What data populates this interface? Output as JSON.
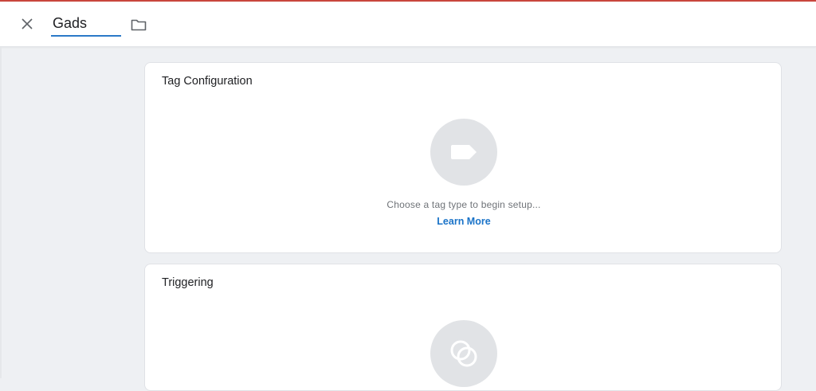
{
  "header": {
    "close_icon": "close-icon",
    "name_value": "Gads",
    "folder_icon": "folder-icon"
  },
  "tag_configuration": {
    "title": "Tag Configuration",
    "icon": "tag-icon",
    "hint": "Choose a tag type to begin setup...",
    "learn_more": "Learn More"
  },
  "triggering": {
    "title": "Triggering",
    "icon": "trigger-icon"
  },
  "colors": {
    "accent_blue": "#1a73c8",
    "underline_blue": "#2b79c8",
    "icon_circle": "#e1e3e6",
    "background": "#eef0f3"
  }
}
